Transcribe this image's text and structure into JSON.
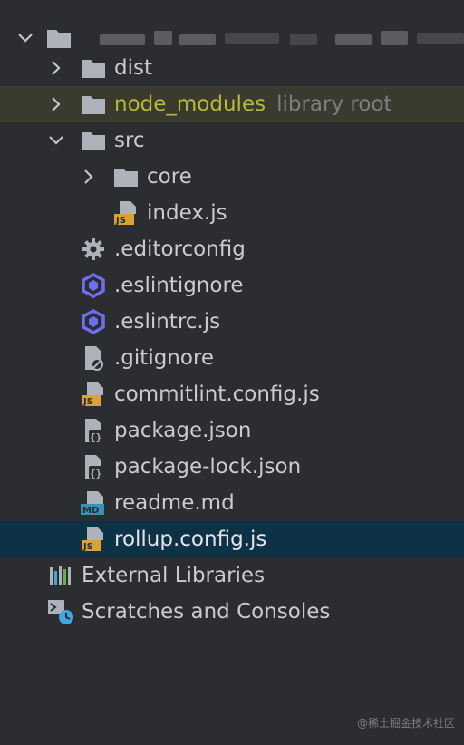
{
  "tree": {
    "root": {
      "label_blurred": true
    },
    "items": [
      {
        "label": "dist",
        "type": "folder",
        "expanded": false,
        "depth": 1
      },
      {
        "label": "node_modules",
        "hint": "library root",
        "type": "folder",
        "expanded": false,
        "depth": 1,
        "highlight": "library"
      },
      {
        "label": "src",
        "type": "folder",
        "expanded": true,
        "depth": 1
      },
      {
        "label": "core",
        "type": "folder",
        "expanded": false,
        "depth": 2
      },
      {
        "label": "index.js",
        "type": "js-file",
        "depth": 2
      },
      {
        "label": ".editorconfig",
        "type": "gear-file",
        "depth": 1
      },
      {
        "label": ".eslintignore",
        "type": "eslint-file",
        "depth": 1
      },
      {
        "label": ".eslintrc.js",
        "type": "eslint-file",
        "depth": 1
      },
      {
        "label": ".gitignore",
        "type": "ignore-file",
        "depth": 1
      },
      {
        "label": "commitlint.config.js",
        "type": "js-file",
        "depth": 1
      },
      {
        "label": "package.json",
        "type": "json-file",
        "depth": 1
      },
      {
        "label": "package-lock.json",
        "type": "json-file",
        "depth": 1
      },
      {
        "label": "readme.md",
        "type": "md-file",
        "depth": 1
      },
      {
        "label": "rollup.config.js",
        "type": "js-file",
        "depth": 1,
        "selected": true
      }
    ],
    "external": {
      "label": "External Libraries"
    },
    "scratches": {
      "label": "Scratches and Consoles"
    }
  },
  "watermark": "@稀土掘金技术社区",
  "colors": {
    "background": "#2b2d30",
    "selected_row": "#0d3145",
    "library_row": "#3a3a2e",
    "library_text": "#b7b93b",
    "folder_icon": "#aeb3bb",
    "js_badge": "#d8a13a",
    "md_badge": "#3b8fb8",
    "eslint_icon": "#6e6ff0",
    "clock_icon": "#3fa6e0"
  },
  "icons": {
    "folder": "folder-icon",
    "js": "js-file-icon",
    "json": "json-file-icon",
    "md": "markdown-file-icon",
    "gear": "gear-icon",
    "eslint": "eslint-icon",
    "ignore": "ignore-file-icon",
    "libraries": "external-libraries-icon",
    "scratches": "scratches-icon"
  }
}
